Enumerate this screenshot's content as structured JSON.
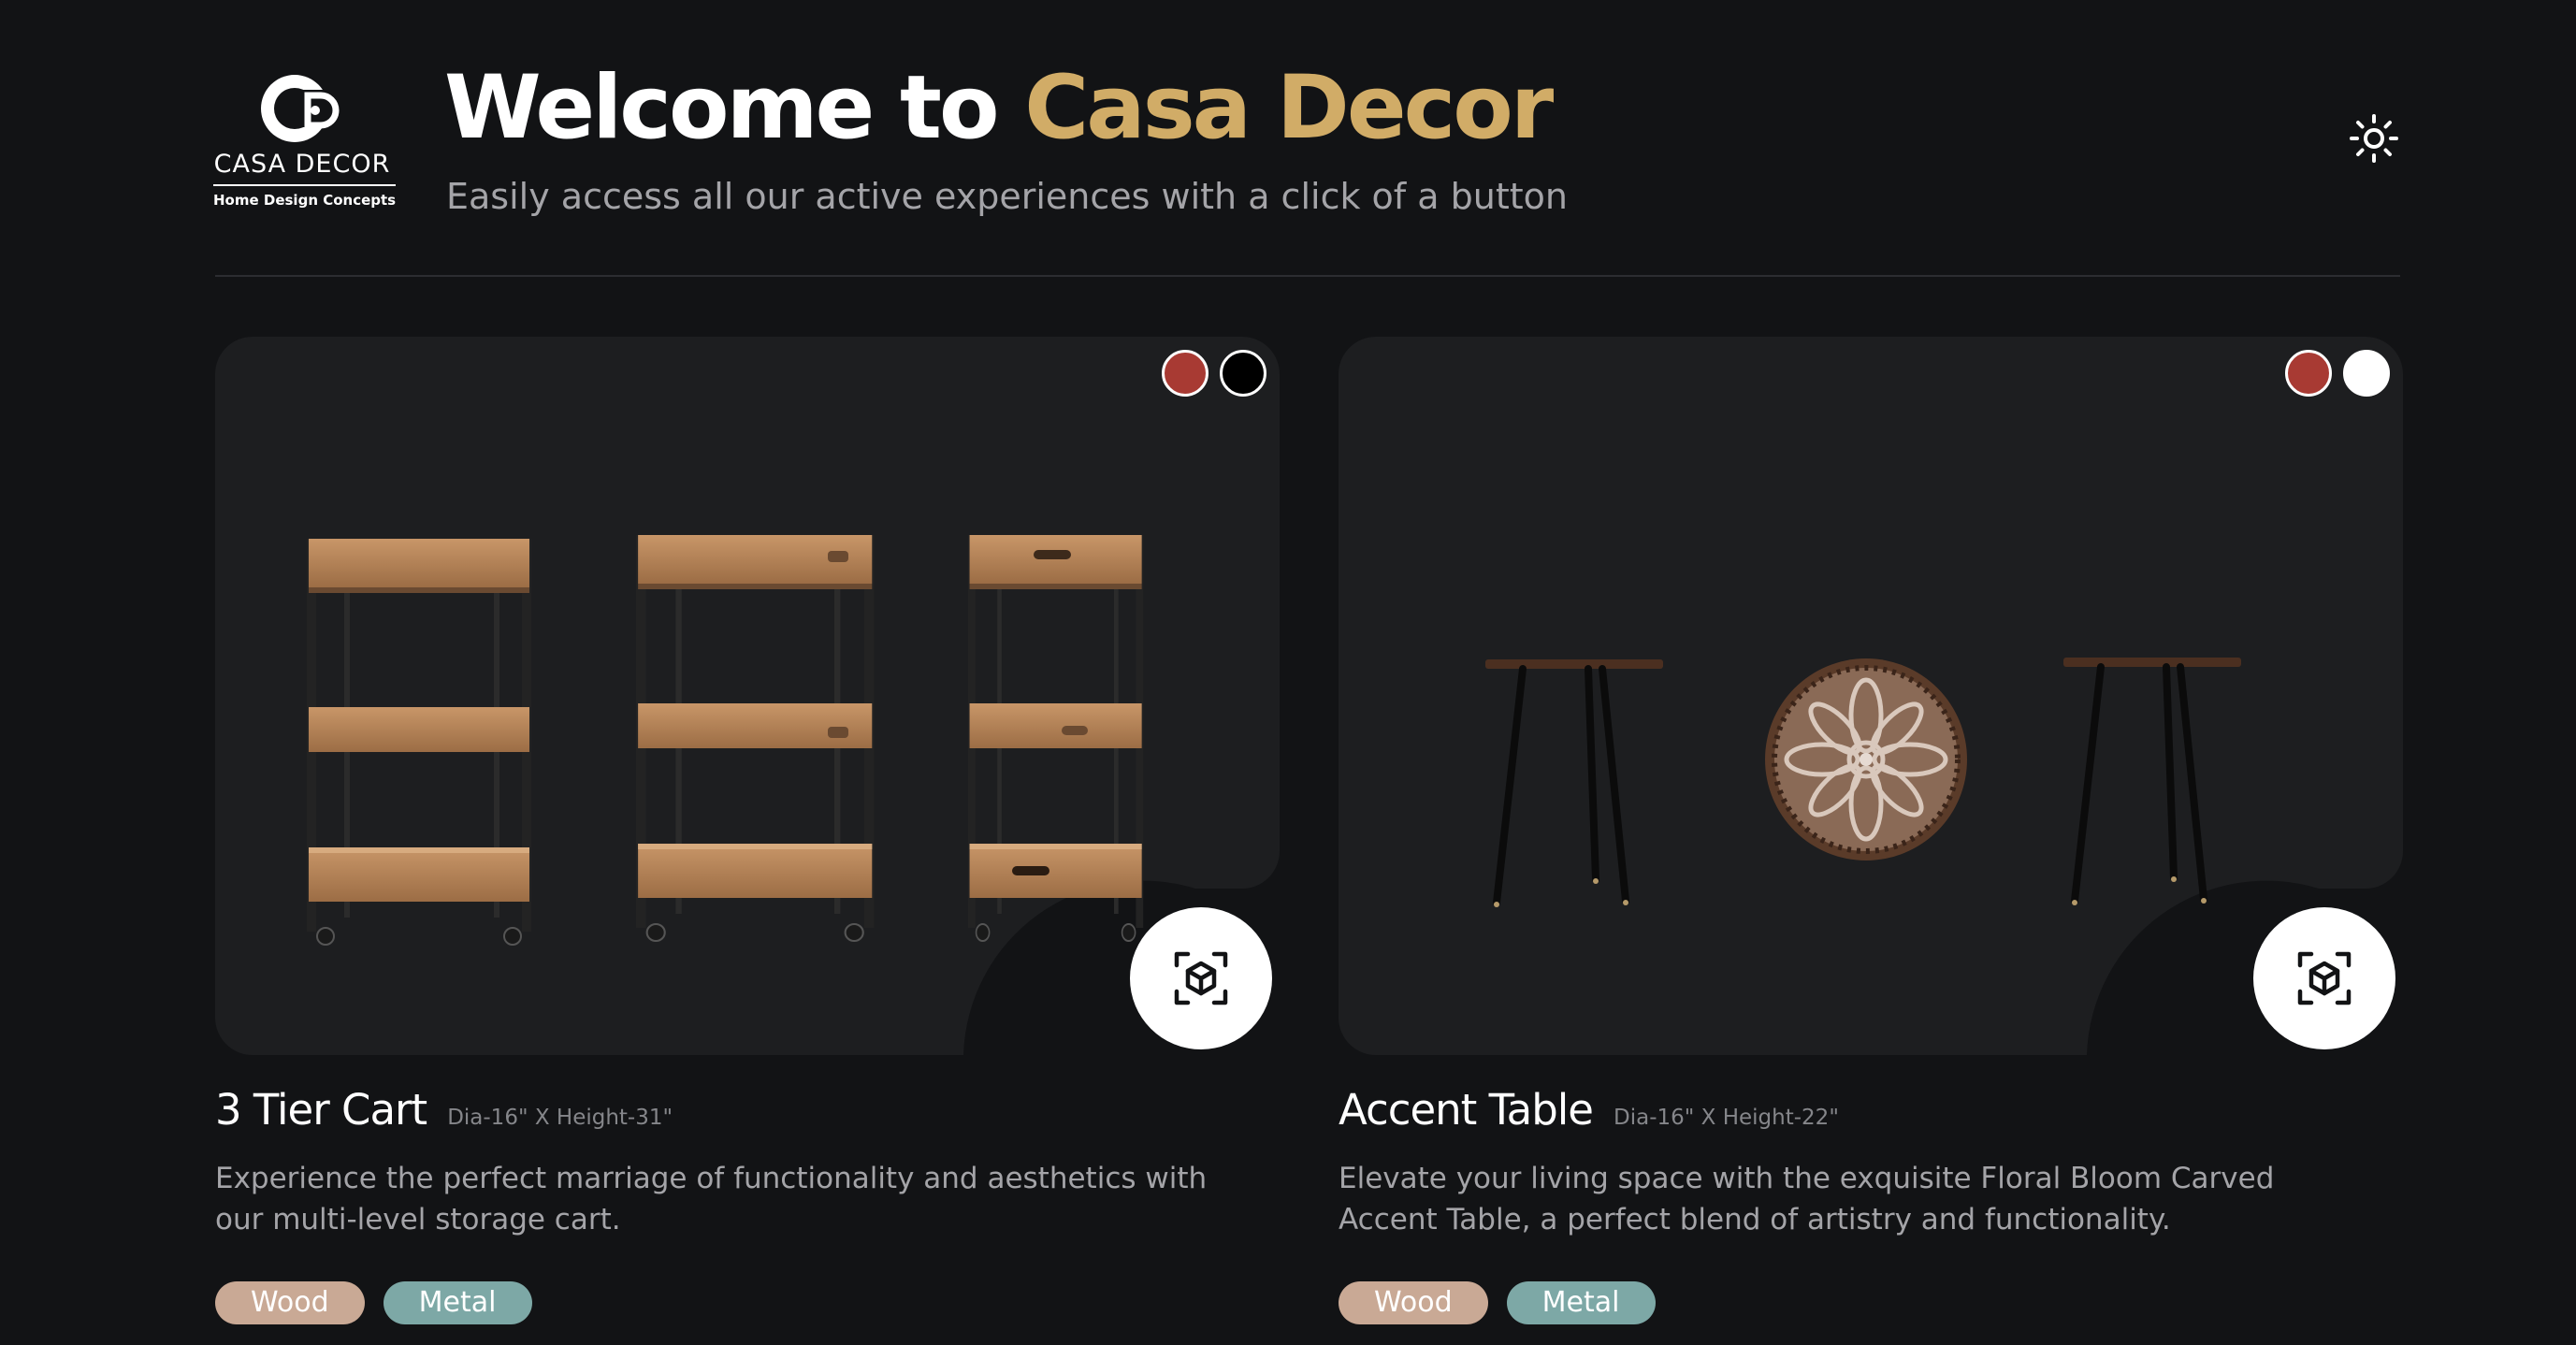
{
  "header": {
    "logo": {
      "name": "CASA DECOR",
      "tagline": "Home Design Concepts"
    },
    "title_prefix": "Welcome to ",
    "title_brand": "Casa Decor",
    "subtitle": "Easily access all our active experiences with a click of a button",
    "theme_icon": "sun-icon"
  },
  "colors": {
    "background": "#121315",
    "card": "#1d1e20",
    "brand_gold": "#d1ac67",
    "tag_wood": "#c9a995",
    "tag_metal": "#7da8a6",
    "swatch_red": "#a83a33"
  },
  "products": [
    {
      "name": "3 Tier Cart",
      "dimensions": "Dia-16\" X Height-31\"",
      "description": "Experience the perfect marriage of functionality and aesthetics with our multi-level storage cart.",
      "swatches": [
        "#a83a33",
        "#000000"
      ],
      "tags": [
        "Wood",
        "Metal"
      ],
      "ar_icon": "ar-cube-icon"
    },
    {
      "name": "Accent Table",
      "dimensions": "Dia-16\" X Height-22\"",
      "description": "Elevate your living space with the exquisite Floral Bloom Carved Accent Table, a perfect blend of artistry and functionality.",
      "swatches": [
        "#a83a33",
        "#ffffff"
      ],
      "tags": [
        "Wood",
        "Metal"
      ],
      "ar_icon": "ar-cube-icon"
    }
  ]
}
